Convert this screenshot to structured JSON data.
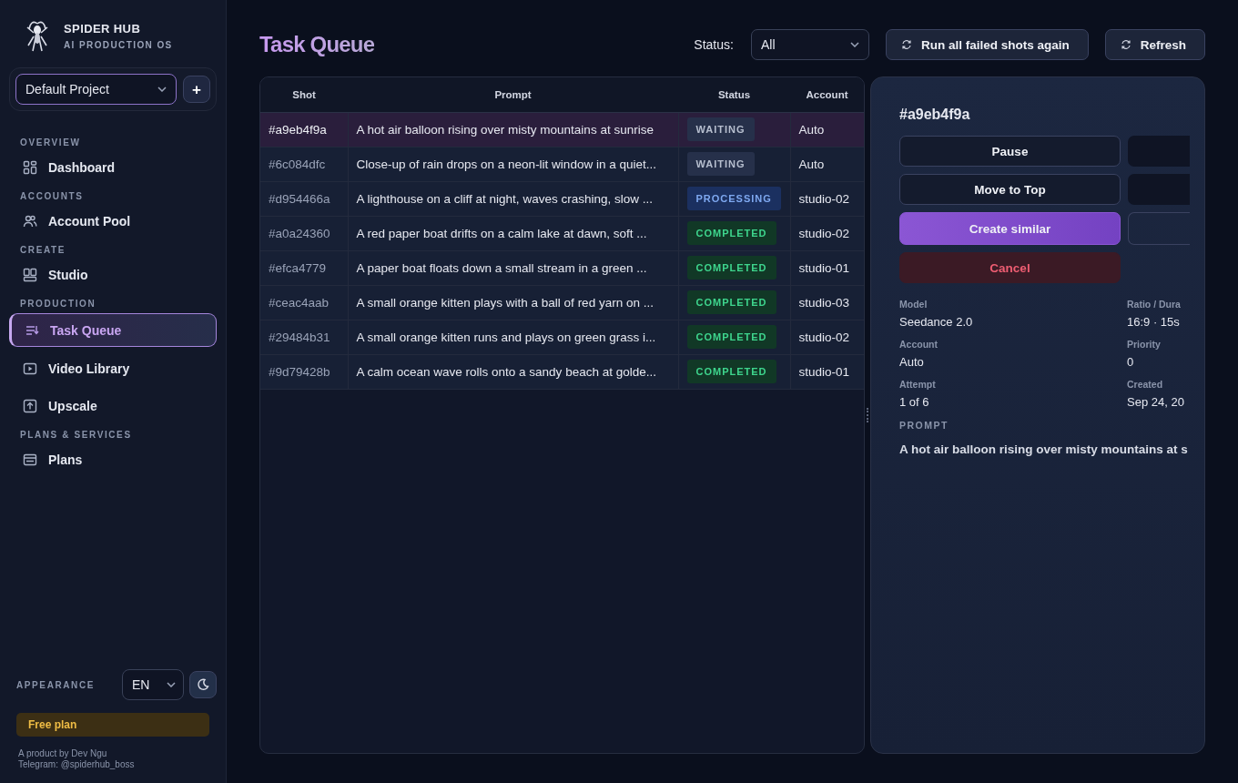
{
  "brand": {
    "name": "SPIDER HUB",
    "tagline": "AI PRODUCTION OS"
  },
  "project": {
    "value": "Default Project",
    "add_label": "+"
  },
  "sidebar": {
    "sections": [
      {
        "title": "OVERVIEW",
        "items": [
          {
            "label": "Dashboard",
            "kind": "grid",
            "selected": false
          }
        ]
      },
      {
        "title": "ACCOUNTS",
        "items": [
          {
            "label": "Account Pool",
            "kind": "users",
            "selected": false
          }
        ]
      },
      {
        "title": "CREATE",
        "items": [
          {
            "label": "Studio",
            "kind": "studio",
            "selected": false
          }
        ]
      },
      {
        "title": "PRODUCTION",
        "items": [
          {
            "label": "Task Queue",
            "kind": "queue",
            "selected": true
          },
          {
            "label": "Video Library",
            "kind": "video",
            "selected": false
          },
          {
            "label": "Upscale",
            "kind": "upload",
            "selected": false
          }
        ]
      },
      {
        "title": "PLANS & SERVICES",
        "items": [
          {
            "label": "Plans",
            "kind": "card",
            "selected": false
          }
        ]
      }
    ]
  },
  "appearance": {
    "label": "APPEARANCE",
    "language": "EN"
  },
  "plan_badge": "Free plan",
  "footer": [
    "A product by Dev Ngu",
    "Telegram: @spiderhub_boss"
  ],
  "page_title": "Task Queue",
  "filter": {
    "label": "Status:",
    "value": "All"
  },
  "actions": [
    "Run all failed shots again",
    "Refresh"
  ],
  "table": {
    "columns": [
      "Shot",
      "Prompt",
      "Status",
      "Account"
    ],
    "rows": [
      {
        "shot": "#a9eb4f9a",
        "prompt": "A hot air balloon rising over misty mountains at sunrise",
        "status": "WAITING",
        "kind": "waiting",
        "account": "Auto",
        "selected": true
      },
      {
        "shot": "#6c084dfc",
        "prompt": "Close-up of rain drops on a neon-lit window in a quiet...",
        "status": "WAITING",
        "kind": "waiting",
        "account": "Auto",
        "selected": false
      },
      {
        "shot": "#d954466a",
        "prompt": "A lighthouse on a cliff at night, waves crashing, slow ...",
        "status": "PROCESSING",
        "kind": "processing",
        "account": "studio-02",
        "selected": false
      },
      {
        "shot": "#a0a24360",
        "prompt": "A red paper boat drifts on a calm lake at dawn, soft ...",
        "status": "COMPLETED",
        "kind": "completed",
        "account": "studio-02",
        "selected": false
      },
      {
        "shot": "#efca4779",
        "prompt": "A paper boat floats down a small stream in a green ...",
        "status": "COMPLETED",
        "kind": "completed",
        "account": "studio-01",
        "selected": false
      },
      {
        "shot": "#ceac4aab",
        "prompt": "A small orange kitten plays with a ball of red yarn on ...",
        "status": "COMPLETED",
        "kind": "completed",
        "account": "studio-03",
        "selected": false
      },
      {
        "shot": "#29484b31",
        "prompt": "A small orange kitten runs and plays on green grass i...",
        "status": "COMPLETED",
        "kind": "completed",
        "account": "studio-02",
        "selected": false
      },
      {
        "shot": "#9d79428b",
        "prompt": "A calm ocean wave rolls onto a sandy beach at golde...",
        "status": "COMPLETED",
        "kind": "completed",
        "account": "studio-01",
        "selected": false
      }
    ]
  },
  "detail": {
    "title": "#a9eb4f9a",
    "buttons": [
      {
        "label": "Pause",
        "kind": "plain"
      },
      {
        "label": "Move to Top",
        "kind": "plain"
      },
      {
        "label": "Create similar",
        "kind": "primary"
      },
      {
        "label": "Cancel",
        "kind": "danger"
      }
    ],
    "fields": [
      {
        "label": "Model",
        "value": "Seedance 2.0"
      },
      {
        "label": "Ratio / Dura",
        "value": "16:9 · 15s"
      },
      {
        "label": "Account",
        "value": "Auto"
      },
      {
        "label": "Priority",
        "value": "0"
      },
      {
        "label": "Attempt",
        "value": "1 of 6"
      },
      {
        "label": "Created",
        "value": "Sep 24, 20"
      }
    ],
    "prompt_label": "PROMPT",
    "prompt": "A hot air balloon rising over misty mountains at s"
  }
}
